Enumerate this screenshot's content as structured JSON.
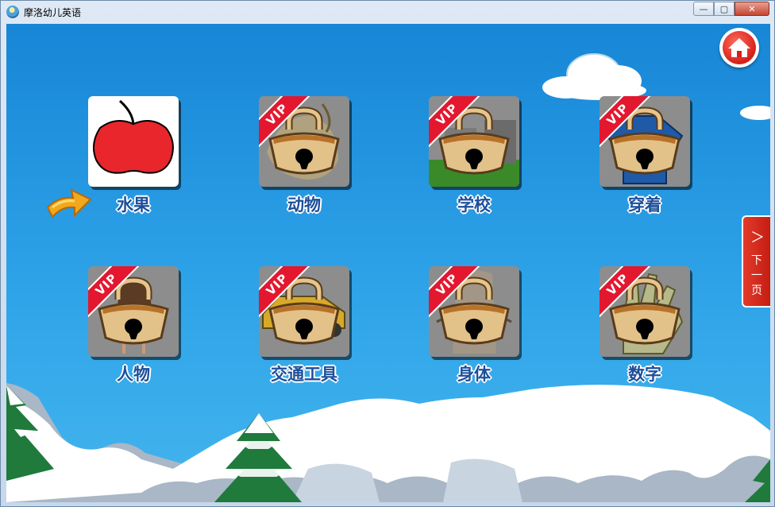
{
  "window": {
    "title": "摩洛幼儿英语"
  },
  "controls": {
    "minimize": "—",
    "maximize": "▢",
    "close": "✕"
  },
  "home": {
    "icon": "home-icon"
  },
  "next_page": {
    "chevron": "＞",
    "label": "下一页"
  },
  "categories": [
    {
      "label": "水果",
      "locked": false,
      "badge": ""
    },
    {
      "label": "动物",
      "locked": true,
      "badge": "VIP"
    },
    {
      "label": "学校",
      "locked": true,
      "badge": "VIP"
    },
    {
      "label": "穿着",
      "locked": true,
      "badge": "VIP"
    },
    {
      "label": "人物",
      "locked": true,
      "badge": "VIP"
    },
    {
      "label": "交通工具",
      "locked": true,
      "badge": "VIP"
    },
    {
      "label": "身体",
      "locked": true,
      "badge": "VIP"
    },
    {
      "label": "数字",
      "locked": true,
      "badge": "VIP"
    }
  ],
  "colors": {
    "sky": "#1786d6",
    "label": "#1d4f9b",
    "vip": "#e3182f",
    "home": "#d6201a"
  }
}
